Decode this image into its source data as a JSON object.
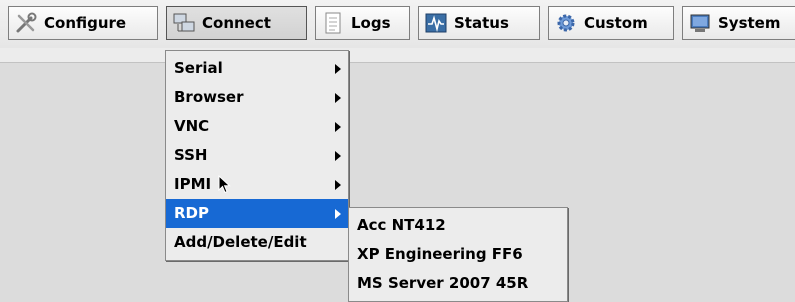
{
  "toolbar": {
    "buttons": [
      {
        "label": "Configure",
        "icon": "tools-icon"
      },
      {
        "label": "Connect",
        "icon": "connect-icon"
      },
      {
        "label": "Logs",
        "icon": "logs-icon"
      },
      {
        "label": "Status",
        "icon": "status-icon"
      },
      {
        "label": "Custom",
        "icon": "gear-icon"
      },
      {
        "label": "System",
        "icon": "monitor-icon"
      }
    ]
  },
  "connect_menu": {
    "items": [
      {
        "label": "Serial",
        "has_submenu": true
      },
      {
        "label": "Browser",
        "has_submenu": true
      },
      {
        "label": "VNC",
        "has_submenu": true
      },
      {
        "label": "SSH",
        "has_submenu": true
      },
      {
        "label": "IPMI",
        "has_submenu": true
      },
      {
        "label": "RDP",
        "has_submenu": true,
        "selected": true
      },
      {
        "label": "Add/Delete/Edit",
        "has_submenu": false
      }
    ]
  },
  "rdp_submenu": {
    "items": [
      {
        "label": "Acc NT412"
      },
      {
        "label": "XP Engineering FF6"
      },
      {
        "label": "MS Server 2007 45R"
      }
    ]
  },
  "colors": {
    "selection": "#1769d4",
    "background": "#dcdcdc"
  }
}
